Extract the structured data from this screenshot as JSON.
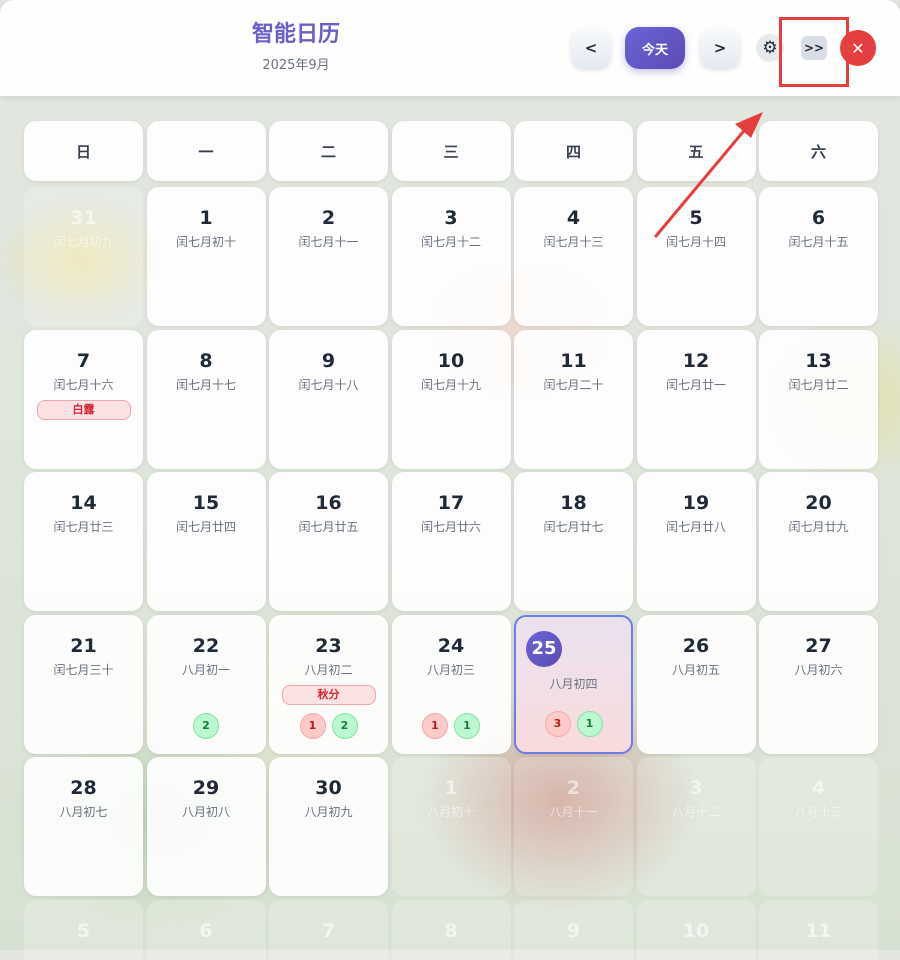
{
  "header": {
    "title": "智能日历",
    "subtitle": "2025年9月",
    "prev_label": "<",
    "today_label": "今天",
    "next_label": ">",
    "settings_icon": "gear-icon",
    "skip_label": ">>",
    "close_label": "✕"
  },
  "weekdays": [
    "日",
    "一",
    "二",
    "三",
    "四",
    "五",
    "六"
  ],
  "days": [
    {
      "num": "31",
      "lunar": "闰七月初九",
      "other": true
    },
    {
      "num": "1",
      "lunar": "闰七月初十"
    },
    {
      "num": "2",
      "lunar": "闰七月十一"
    },
    {
      "num": "3",
      "lunar": "闰七月十二"
    },
    {
      "num": "4",
      "lunar": "闰七月十三"
    },
    {
      "num": "5",
      "lunar": "闰七月十四"
    },
    {
      "num": "6",
      "lunar": "闰七月十五"
    },
    {
      "num": "7",
      "lunar": "闰七月十六",
      "festival": "白露"
    },
    {
      "num": "8",
      "lunar": "闰七月十七"
    },
    {
      "num": "9",
      "lunar": "闰七月十八"
    },
    {
      "num": "10",
      "lunar": "闰七月十九"
    },
    {
      "num": "11",
      "lunar": "闰七月二十"
    },
    {
      "num": "12",
      "lunar": "闰七月廿一"
    },
    {
      "num": "13",
      "lunar": "闰七月廿二"
    },
    {
      "num": "14",
      "lunar": "闰七月廿三"
    },
    {
      "num": "15",
      "lunar": "闰七月廿四"
    },
    {
      "num": "16",
      "lunar": "闰七月廿五"
    },
    {
      "num": "17",
      "lunar": "闰七月廿六"
    },
    {
      "num": "18",
      "lunar": "闰七月廿七"
    },
    {
      "num": "19",
      "lunar": "闰七月廿八"
    },
    {
      "num": "20",
      "lunar": "闰七月廿九"
    },
    {
      "num": "21",
      "lunar": "闰七月三十"
    },
    {
      "num": "22",
      "lunar": "八月初一",
      "badges": [
        {
          "type": "green",
          "count": "2"
        }
      ]
    },
    {
      "num": "23",
      "lunar": "八月初二",
      "festival": "秋分",
      "badges": [
        {
          "type": "red",
          "count": "1"
        },
        {
          "type": "green",
          "count": "2"
        }
      ]
    },
    {
      "num": "24",
      "lunar": "八月初三",
      "badges": [
        {
          "type": "red",
          "count": "1"
        },
        {
          "type": "green",
          "count": "1"
        }
      ]
    },
    {
      "num": "25",
      "lunar": "八月初四",
      "today": true,
      "badges": [
        {
          "type": "red",
          "count": "3"
        },
        {
          "type": "green",
          "count": "1"
        }
      ]
    },
    {
      "num": "26",
      "lunar": "八月初五"
    },
    {
      "num": "27",
      "lunar": "八月初六"
    },
    {
      "num": "28",
      "lunar": "八月初七"
    },
    {
      "num": "29",
      "lunar": "八月初八"
    },
    {
      "num": "30",
      "lunar": "八月初九"
    },
    {
      "num": "1",
      "lunar": "八月初十",
      "other": true
    },
    {
      "num": "2",
      "lunar": "八月十一",
      "other": true
    },
    {
      "num": "3",
      "lunar": "八月十二",
      "other": true
    },
    {
      "num": "4",
      "lunar": "八月十三",
      "other": true
    }
  ],
  "next_row": [
    "5",
    "6",
    "7",
    "8",
    "9",
    "10",
    "11"
  ],
  "colors": {
    "accent": "#6b5ec7",
    "highlight": "#e53e3e",
    "badge_red": "#fecaca",
    "badge_green": "#bbf7d0"
  }
}
